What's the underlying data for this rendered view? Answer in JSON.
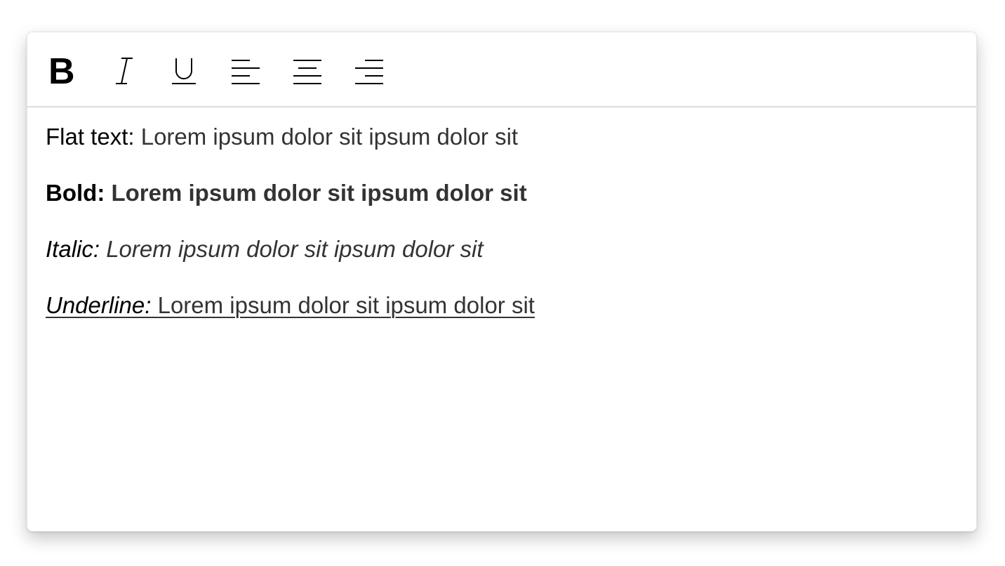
{
  "toolbar": {
    "buttons": [
      {
        "name": "bold",
        "icon": "bold-icon"
      },
      {
        "name": "italic",
        "icon": "italic-icon"
      },
      {
        "name": "underline",
        "icon": "underline-icon"
      },
      {
        "name": "align-left",
        "icon": "align-left-icon"
      },
      {
        "name": "align-center",
        "icon": "align-center-icon"
      },
      {
        "name": "align-right",
        "icon": "align-right-icon"
      }
    ]
  },
  "content": {
    "flat": {
      "label": "Flat text:",
      "text": " Lorem ipsum dolor sit ipsum dolor sit"
    },
    "bold": {
      "label": "Bold:",
      "text": " Lorem ipsum dolor sit ipsum dolor sit"
    },
    "italic": {
      "label": "Italic:",
      "text": " Lorem ipsum dolor sit ipsum dolor sit"
    },
    "underline": {
      "label": "Underline:",
      "text": " Lorem ipsum dolor sit ipsum dolor sit"
    }
  },
  "colors": {
    "label": "#000000",
    "text": "#333333",
    "divider": "#dcdcdc"
  }
}
